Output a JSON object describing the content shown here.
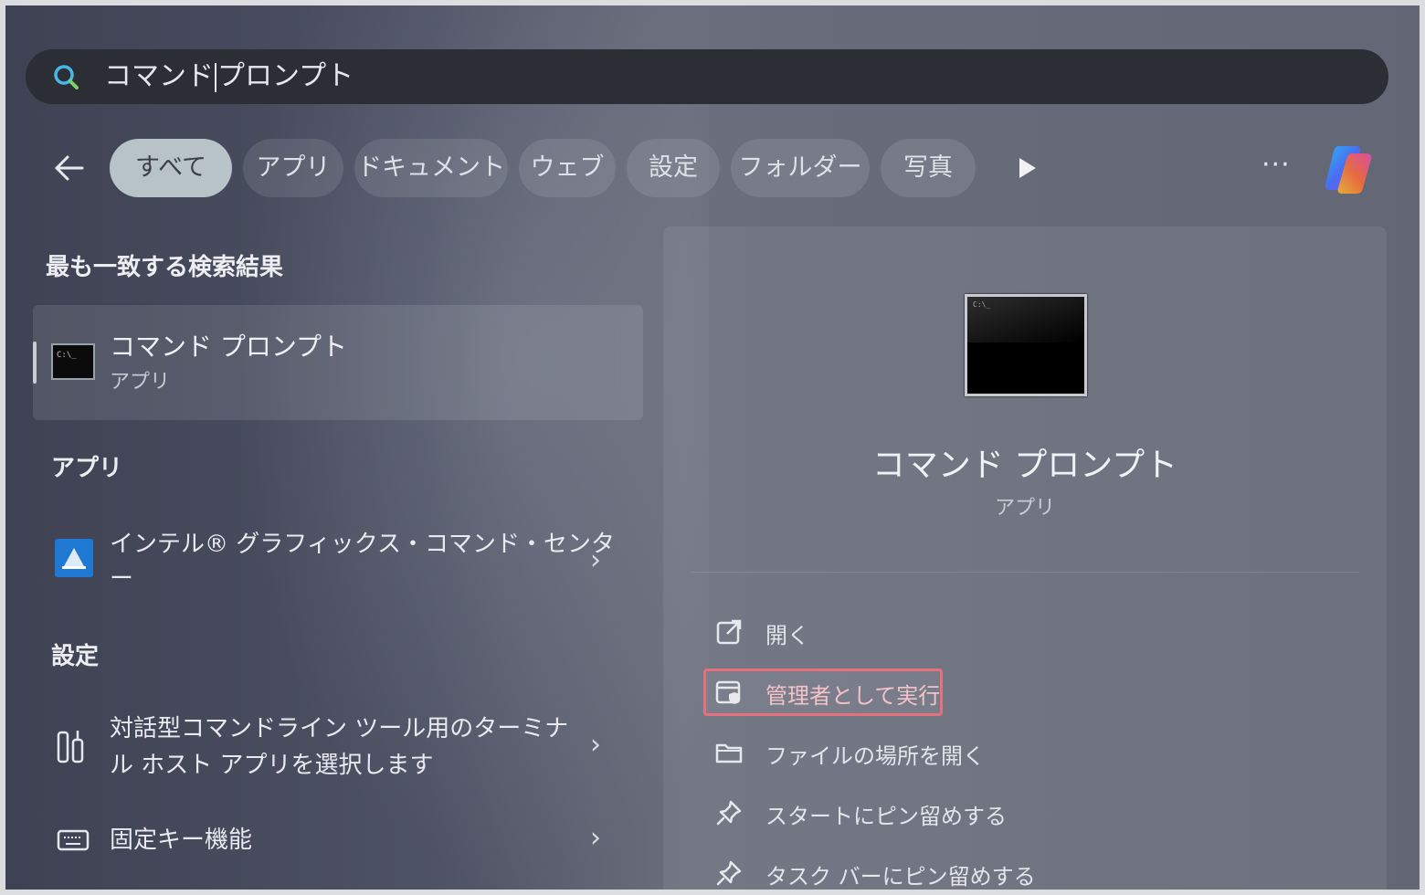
{
  "search": {
    "query_before_caret": "コマンド",
    "query_after_caret": "プロンプト"
  },
  "filters": [
    {
      "label": "すべて",
      "active": true
    },
    {
      "label": "アプリ"
    },
    {
      "label": "ドキュメント"
    },
    {
      "label": "ウェブ"
    },
    {
      "label": "設定"
    },
    {
      "label": "フォルダー"
    },
    {
      "label": "写真"
    }
  ],
  "more_label": "···",
  "best_match": {
    "heading": "最も一致する検索結果",
    "title": "コマンド プロンプト",
    "subtitle": "アプリ"
  },
  "apps": {
    "heading": "アプリ",
    "items": [
      {
        "line1": "インテル® グラフィックス・コマンド・センタ",
        "line2": "ー"
      }
    ]
  },
  "settings": {
    "heading": "設定",
    "items": [
      {
        "line1": "対話型コマンドライン ツール用のターミナ",
        "line2": "ル ホスト アプリを選択します"
      },
      {
        "line1": "固定キー機能",
        "line2": ""
      }
    ]
  },
  "details": {
    "title": "コマンド プロンプト",
    "subtitle": "アプリ",
    "actions": [
      {
        "label": "開く",
        "icon": "open-external-icon"
      },
      {
        "label": "管理者として実行",
        "icon": "run-as-admin-icon",
        "highlighted": true
      },
      {
        "label": "ファイルの場所を開く",
        "icon": "folder-icon"
      },
      {
        "label": "スタートにピン留めする",
        "icon": "pin-icon"
      },
      {
        "label": "タスク バーにピン留めする",
        "icon": "pin-icon"
      }
    ]
  },
  "colors": {
    "highlight_border": "#e8707d",
    "active_chip": "#b7c3c8",
    "search_bar": "#2c2e35"
  }
}
